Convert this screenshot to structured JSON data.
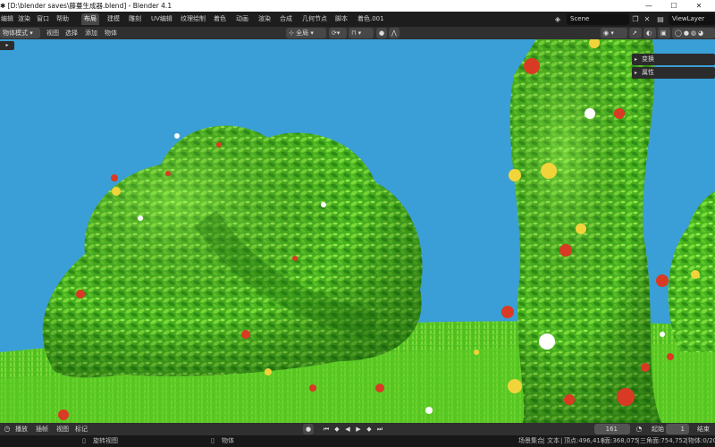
{
  "window": {
    "title": "✱ [D:\\blender saves\\藤蔓生成器.blend] - Blender 4.1",
    "minimize": "—",
    "maximize": "☐",
    "close": "✕"
  },
  "menu": {
    "items": [
      "编辑",
      "渲染",
      "窗口",
      "帮助"
    ],
    "workspaces": [
      "布局",
      "建模",
      "雕刻",
      "UV编辑",
      "纹理绘制",
      "着色",
      "动画",
      "渲染",
      "合成",
      "几何节点",
      "脚本",
      "着色.001"
    ],
    "active_workspace": "布局",
    "scene": "Scene",
    "view_layer": "ViewLayer"
  },
  "header": {
    "mode": "物体模式",
    "menus": [
      "视图",
      "选择",
      "添加",
      "物体"
    ],
    "transform_orientation": "全局"
  },
  "sidebar": {
    "panels": [
      "变换",
      "属性"
    ]
  },
  "timeline": {
    "menus": [
      "播放",
      "插帧",
      "视图",
      "标记"
    ],
    "current_frame": "161",
    "start_label": "起始",
    "start_value": "1",
    "end_label": "结束"
  },
  "status": {
    "rotate": "旋转视图",
    "object": "物体",
    "collection": "场景集合",
    "text": "文本",
    "verts": "顶点:496,418",
    "faces": "面:368,075",
    "tris": "三角面:754,752",
    "objects": "物体:0/20"
  },
  "colors": {
    "sky": "#3a9fd6",
    "grass": "#55c522",
    "foliage": "#46b21e",
    "accent_red": "#d93a24",
    "accent_yellow": "#f1d43a"
  }
}
